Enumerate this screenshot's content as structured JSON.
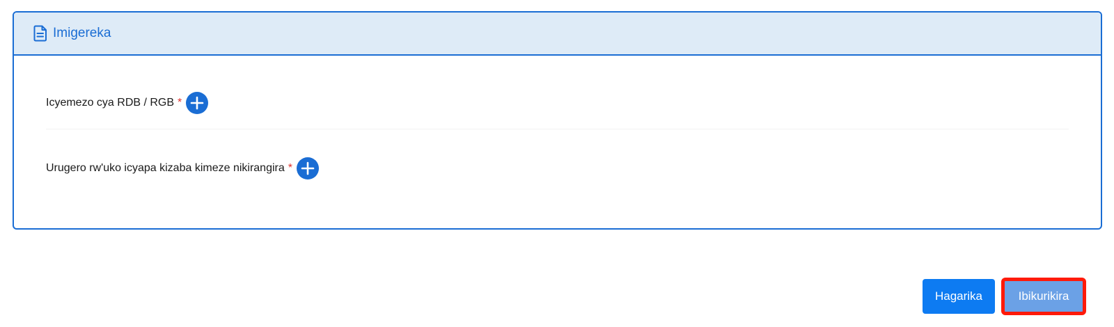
{
  "section": {
    "title": "Imigereka",
    "icon": "document-icon"
  },
  "fields": [
    {
      "label": "Icyemezo cya RDB / RGB",
      "required_mark": "*",
      "action_icon": "plus-circle-icon"
    },
    {
      "label": "Urugero rw'uko icyapa kizaba kimeze nikirangira",
      "required_mark": "*",
      "action_icon": "plus-circle-icon"
    }
  ],
  "footer": {
    "cancel_label": "Hagarika",
    "next_label": "Ibikurikira"
  },
  "colors": {
    "accent": "#1a6dd4",
    "header_bg": "#deebf7",
    "required": "#e0312d",
    "cancel_bg": "#0d7bf2",
    "next_bg": "#6ba1e6",
    "highlight": "#ff1a0a"
  }
}
